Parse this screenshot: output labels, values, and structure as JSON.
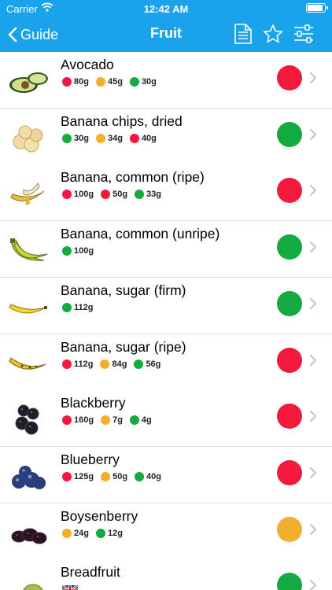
{
  "status_bar": {
    "carrier": "Carrier",
    "time": "12:42 AM",
    "battery_level": 0.95
  },
  "nav": {
    "back_label": "Guide",
    "title": "Fruit",
    "icons": [
      "chevron-left-icon",
      "document-icon",
      "star-icon",
      "sliders-icon"
    ]
  },
  "colors": {
    "red": "#f5193e",
    "orange": "#f5ae2b",
    "green": "#13aa40",
    "header": "#1aa3ea"
  },
  "items": [
    {
      "name": "Avocado",
      "thumb": "avocado-icon",
      "status": "red",
      "portions": [
        {
          "color": "red",
          "value": "80g"
        },
        {
          "color": "orange",
          "value": "45g"
        },
        {
          "color": "green",
          "value": "30g"
        }
      ]
    },
    {
      "name": "Banana chips, dried",
      "thumb": "banana-chips-icon",
      "status": "green",
      "portions": [
        {
          "color": "green",
          "value": "30g"
        },
        {
          "color": "orange",
          "value": "34g"
        },
        {
          "color": "red",
          "value": "40g"
        }
      ]
    },
    {
      "name": "Banana, common (ripe)",
      "thumb": "ripe-banana-icon",
      "status": "red",
      "portions": [
        {
          "color": "red",
          "value": "100g"
        },
        {
          "color": "red",
          "value": "50g"
        },
        {
          "color": "green",
          "value": "33g"
        }
      ]
    },
    {
      "name": "Banana, common (unripe)",
      "thumb": "unripe-banana-icon",
      "status": "green",
      "portions": [
        {
          "color": "green",
          "value": "100g"
        }
      ]
    },
    {
      "name": "Banana, sugar (firm)",
      "thumb": "sugar-banana-icon",
      "status": "green",
      "portions": [
        {
          "color": "green",
          "value": "112g"
        }
      ]
    },
    {
      "name": "Banana, sugar (ripe)",
      "thumb": "sugar-banana-ripe-icon",
      "status": "red",
      "portions": [
        {
          "color": "red",
          "value": "112g"
        },
        {
          "color": "orange",
          "value": "84g"
        },
        {
          "color": "green",
          "value": "56g"
        }
      ]
    },
    {
      "name": "Blackberry",
      "thumb": "blackberry-icon",
      "status": "red",
      "portions": [
        {
          "color": "red",
          "value": "160g"
        },
        {
          "color": "orange",
          "value": "7g"
        },
        {
          "color": "green",
          "value": "4g"
        }
      ]
    },
    {
      "name": "Blueberry",
      "thumb": "blueberry-icon",
      "status": "red",
      "portions": [
        {
          "color": "red",
          "value": "125g"
        },
        {
          "color": "orange",
          "value": "50g"
        },
        {
          "color": "green",
          "value": "40g"
        }
      ]
    },
    {
      "name": "Boysenberry",
      "thumb": "boysenberry-icon",
      "status": "orange",
      "portions": [
        {
          "color": "orange",
          "value": "24g"
        },
        {
          "color": "green",
          "value": "12g"
        }
      ]
    },
    {
      "name": "Breadfruit",
      "thumb": "breadfruit-icon",
      "status": "green",
      "portions": [],
      "flag": "uk-flag-icon"
    }
  ]
}
